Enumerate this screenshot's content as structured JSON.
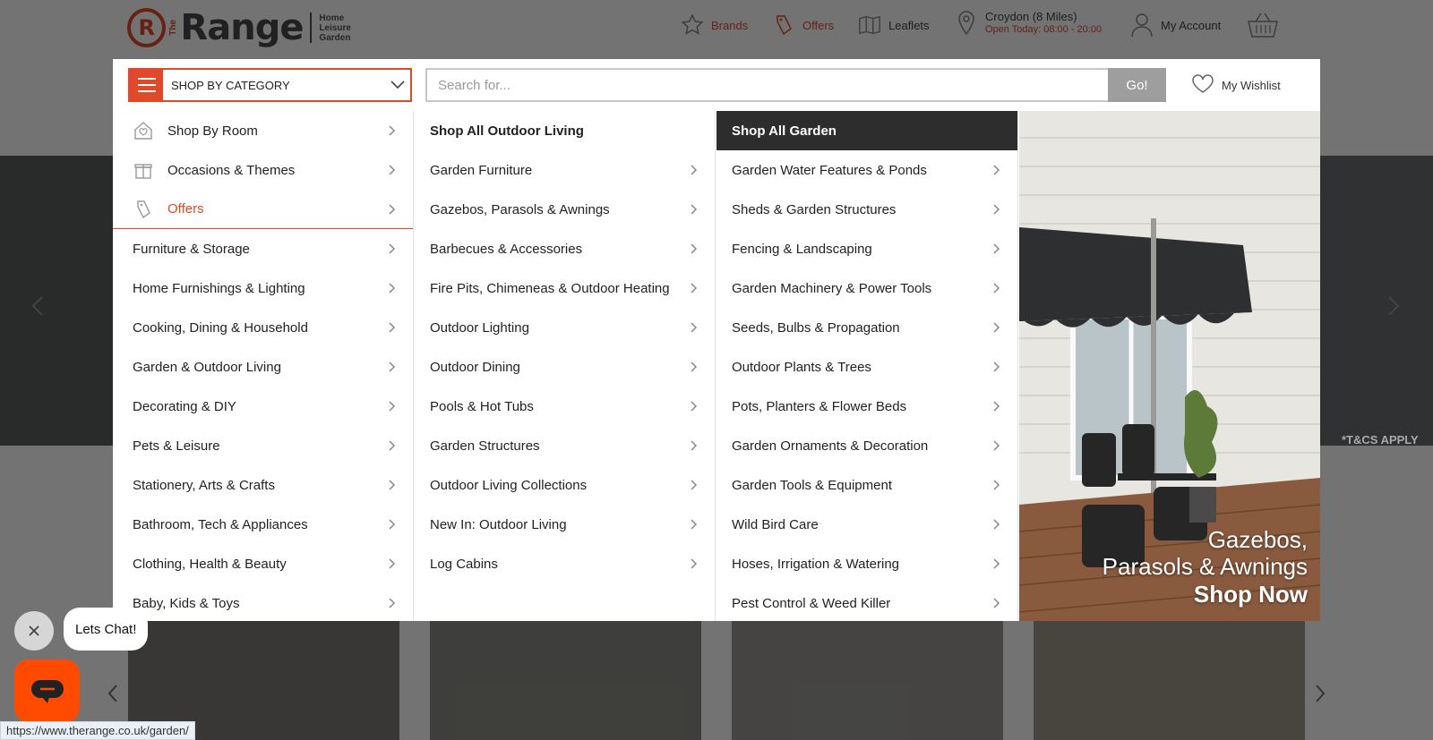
{
  "header": {
    "logo": {
      "the": "The",
      "range": "Range",
      "tag1": "Home",
      "tag2": "Leisure",
      "tag3": "Garden"
    },
    "brands": "Brands",
    "offers": "Offers",
    "leaflets": "Leaflets",
    "store": {
      "name": "Croydon (8 Miles)",
      "hours": "Open Today: 08:00 - 20:00"
    },
    "account": "My Account"
  },
  "search": {
    "category_label": "SHOP BY CATEGORY",
    "placeholder": "Search for...",
    "go_label": "Go!",
    "wishlist_label": "My Wishlist"
  },
  "menu": {
    "col1": [
      {
        "label": "Shop By Room",
        "icon": "house-heart-icon"
      },
      {
        "label": "Occasions & Themes",
        "icon": "gift-icon"
      },
      {
        "label": "Offers",
        "icon": "tag-icon"
      },
      {
        "label": "Furniture & Storage"
      },
      {
        "label": "Home Furnishings & Lighting"
      },
      {
        "label": "Cooking, Dining & Household"
      },
      {
        "label": "Garden & Outdoor Living"
      },
      {
        "label": "Decorating & DIY"
      },
      {
        "label": "Pets & Leisure"
      },
      {
        "label": "Stationery, Arts & Crafts"
      },
      {
        "label": "Bathroom, Tech & Appliances"
      },
      {
        "label": "Clothing, Health & Beauty"
      },
      {
        "label": "Baby, Kids & Toys"
      }
    ],
    "col2": [
      {
        "label": "Shop All Outdoor Living"
      },
      {
        "label": "Garden Furniture"
      },
      {
        "label": "Gazebos, Parasols & Awnings"
      },
      {
        "label": "Barbecues & Accessories"
      },
      {
        "label": "Fire Pits, Chimeneas & Outdoor Heating"
      },
      {
        "label": "Outdoor Lighting"
      },
      {
        "label": "Outdoor Dining"
      },
      {
        "label": "Pools & Hot Tubs"
      },
      {
        "label": "Garden Structures"
      },
      {
        "label": "Outdoor Living Collections"
      },
      {
        "label": "New In: Outdoor Living"
      },
      {
        "label": "Log Cabins"
      }
    ],
    "col3": [
      {
        "label": "Shop All Garden"
      },
      {
        "label": "Garden Water Features & Ponds"
      },
      {
        "label": "Sheds & Garden Structures"
      },
      {
        "label": "Fencing & Landscaping"
      },
      {
        "label": "Garden Machinery & Power Tools"
      },
      {
        "label": "Seeds, Bulbs & Propagation"
      },
      {
        "label": "Outdoor Plants & Trees"
      },
      {
        "label": "Pots, Planters & Flower Beds"
      },
      {
        "label": "Garden Ornaments & Decoration"
      },
      {
        "label": "Garden Tools & Equipment"
      },
      {
        "label": "Wild Bird Care"
      },
      {
        "label": "Hoses, Irrigation & Watering"
      },
      {
        "label": "Pest Control & Weed Killer"
      }
    ],
    "promo": {
      "line1": "Gazebos,",
      "line2": "Parasols & Awnings",
      "line3": "Shop Now"
    }
  },
  "background": {
    "tcs": "*T&CS APPLY"
  },
  "chat": {
    "bubble": "Lets Chat!"
  },
  "status_url": "https://www.therange.co.uk/garden/",
  "colors": {
    "brand": "#e2492a",
    "active_row": "#2d2d2d",
    "chat": "#ff4a00"
  }
}
